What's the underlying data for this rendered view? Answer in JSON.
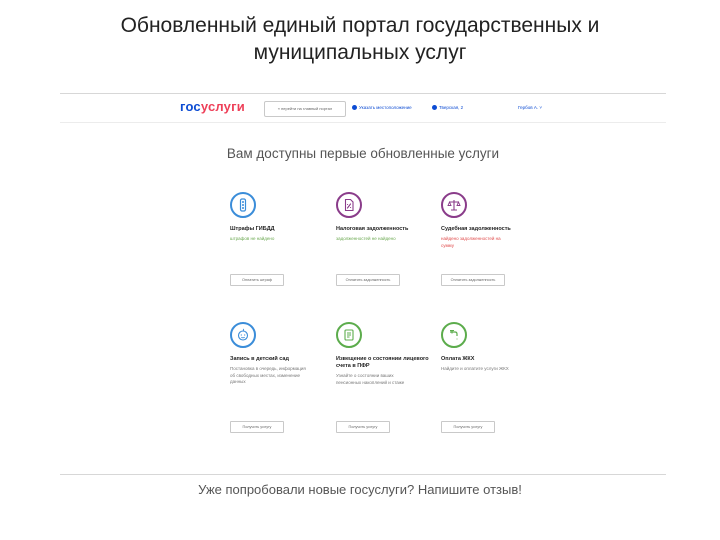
{
  "slide": {
    "title_line1": "Обновленный единый портал государственных и",
    "title_line2": "муниципальных услуг"
  },
  "portal": {
    "logo_gos": "гос",
    "logo_uslugi": "услуги",
    "location_button": "« перейти на главный портал",
    "location_link": "Указать местоположение",
    "region_link": "Тверская, 2",
    "user_link": "Гербов А.  ˅",
    "heading": "Вам доступны первые обновленные услуги",
    "colors": {
      "brand_blue": "#0d4cd3",
      "brand_red": "#ee3f58",
      "icon_blue": "#3b8dd9",
      "icon_purple": "#8a3c8a",
      "icon_green": "#5cac4c",
      "status_green": "#6aa84f",
      "status_red": "#e04b4b"
    }
  },
  "services": [
    {
      "name": "Штрафы ГИБДД",
      "status": "штрафов не найдено",
      "button": "Оплатить штраф",
      "icon": "traffic-light-icon"
    },
    {
      "name": "Налоговая задолженность",
      "status": "задолженностей не найдено",
      "button": "Оплатить задолженность",
      "icon": "tax-document-icon"
    },
    {
      "name": "Судебная задолженность",
      "status": "найдено задолженностей на сумму",
      "button": "Оплатить задолженность",
      "icon": "scales-icon"
    },
    {
      "name": "Запись в детский сад",
      "desc": "Постановка в очередь, информация об свободных местах, изменение данных",
      "button": "Получить услугу",
      "icon": "child-face-icon"
    },
    {
      "name": "Извещение о состоянии лицевого счета в ПФР",
      "desc": "Узнайте о состоянии ваших пенсионных накоплений и стаже",
      "button": "Получить услугу",
      "icon": "pension-document-icon"
    },
    {
      "name": "Оплата ЖКХ",
      "desc": "Найдите и оплатите услуги ЖКХ",
      "button": "Получить услугу",
      "icon": "utility-tap-icon"
    }
  ],
  "feedback": "Уже попробовали новые госуслуги? Напишите отзыв!"
}
